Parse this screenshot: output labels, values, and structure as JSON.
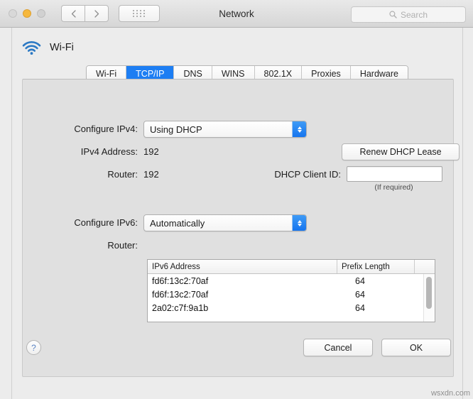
{
  "window": {
    "title": "Network",
    "search_placeholder": "Search",
    "nav_back": "‹",
    "nav_forward": "›"
  },
  "interface": {
    "name": "Wi-Fi",
    "icon": "wifi-icon"
  },
  "tabs": [
    {
      "label": "Wi-Fi",
      "active": false
    },
    {
      "label": "TCP/IP",
      "active": true
    },
    {
      "label": "DNS",
      "active": false
    },
    {
      "label": "WINS",
      "active": false
    },
    {
      "label": "802.1X",
      "active": false
    },
    {
      "label": "Proxies",
      "active": false
    },
    {
      "label": "Hardware",
      "active": false
    }
  ],
  "ipv4": {
    "configure_label": "Configure IPv4:",
    "configure_value": "Using DHCP",
    "address_label": "IPv4 Address:",
    "address_value": "192",
    "router_label": "Router:",
    "router_value": "192",
    "renew_button": "Renew DHCP Lease",
    "client_id_label": "DHCP Client ID:",
    "client_id_value": "",
    "client_id_hint": "(If required)"
  },
  "ipv6": {
    "configure_label": "Configure IPv6:",
    "configure_value": "Automatically",
    "router_label": "Router:",
    "router_value": ""
  },
  "ipv6_table": {
    "columns": [
      "IPv6 Address",
      "Prefix Length"
    ],
    "rows": [
      {
        "address": "fd6f:13c2:70af",
        "prefix": "64"
      },
      {
        "address": "fd6f:13c2:70af",
        "prefix": "64"
      },
      {
        "address": "2a02:c7f:9a1b",
        "prefix": "64"
      }
    ]
  },
  "footer": {
    "help_label": "?",
    "cancel_label": "Cancel",
    "ok_label": "OK"
  },
  "watermark": "wsxdn.com",
  "colors": {
    "accent": "#1d7ef3",
    "wifi_icon": "#1f6fc4",
    "window_bg": "#ececec",
    "panel_bg": "#e0e0e0"
  }
}
